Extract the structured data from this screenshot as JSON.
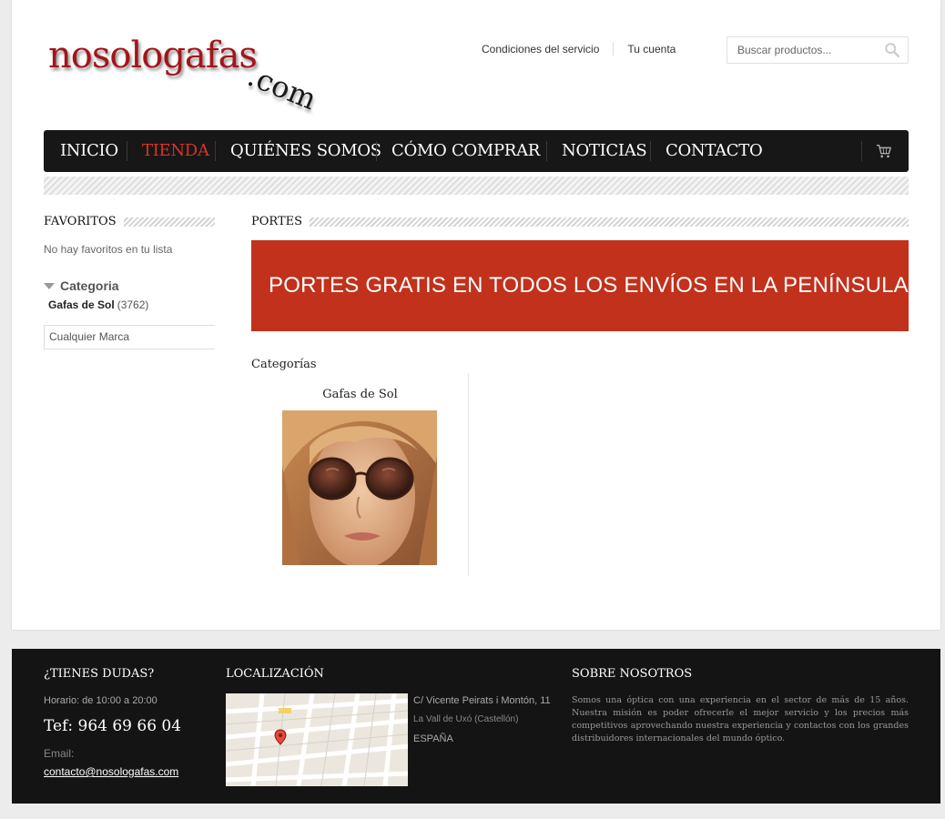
{
  "brand": {
    "logo_main": "nosologafas",
    "logo_suffix": ".com"
  },
  "top_links": [
    "Condiciones del servicio",
    "Tu cuenta"
  ],
  "search": {
    "placeholder": "Buscar productos..."
  },
  "nav": {
    "items": [
      "INICIO",
      "TIENDA",
      "QUIÉNES SOMOS",
      "CÓMO COMPRAR",
      "NOTICIAS",
      "CONTACTO"
    ],
    "active": "TIENDA"
  },
  "sidebar": {
    "favorites_title": "FAVORITOS",
    "favorites_empty": "No hay favoritos en tu lista",
    "category_title": "Categoria",
    "category_item": {
      "label": "Gafas de Sol",
      "count": "(3762)"
    },
    "brand_filter": "Cualquier Marca"
  },
  "main": {
    "section_title": "PORTES",
    "banner_text": "PORTES GRATIS EN TODOS LOS ENVÍOS EN LA PENÍNSULA",
    "categories_label": "Categorías",
    "category_card": {
      "name": "Gafas de Sol"
    }
  },
  "footer": {
    "doubts_title": "¿TIENES DUDAS?",
    "hours": "Horario: de 10:00 a 20:00",
    "phone": "Tef: 964 69 66 04",
    "email_label": "Email:",
    "email": "contacto@nosologafas.com",
    "location_title": "LOCALIZACIÓN",
    "address_line1": "C/ Vicente Peirats i Montón, 11",
    "address_line2": "La Vall de Uxó (Castellón)",
    "address_line3": "ESPAÑA",
    "about_title": "SOBRE NOSOTROS",
    "about_text": "Somos una óptica con una experiencia en el sector de más de 15 años. Nuestra misión es poder ofrecerle el mejor servicio y los precios más competitivos aprovechando nuestra experiencia y contactos con los grandes distribuidores internacionales del mundo óptico."
  },
  "colors": {
    "accent": "#c1311b",
    "nav_bg": "#171717",
    "active_nav": "#d9332a",
    "footer_bg": "#141414"
  }
}
